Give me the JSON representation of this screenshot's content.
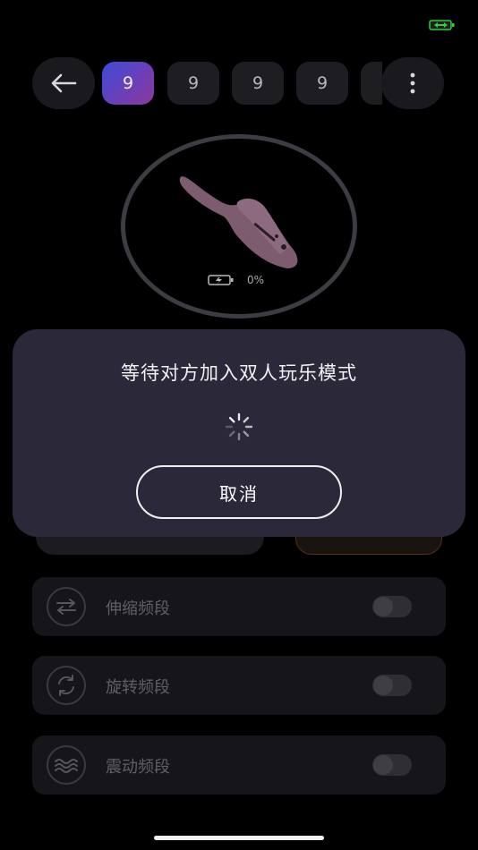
{
  "status": {
    "battery_icon": "battery-charging-icon",
    "battery_color": "#2ecc40"
  },
  "topbar": {
    "back_icon": "arrow-left-icon",
    "chips": [
      {
        "label": "9",
        "active": true
      },
      {
        "label": "9",
        "active": false
      },
      {
        "label": "9",
        "active": false
      },
      {
        "label": "9",
        "active": false
      }
    ],
    "more_icon": "more-vertical-icon"
  },
  "device": {
    "image": "toy-device-image",
    "battery_label": "0%"
  },
  "bands": [
    {
      "label": "伸缩频段",
      "icon": "swap-arrows-icon",
      "enabled": false
    },
    {
      "label": "旋转频段",
      "icon": "rotate-icon",
      "enabled": false
    },
    {
      "label": "震动频段",
      "icon": "wave-icon",
      "enabled": false
    }
  ],
  "modal": {
    "title": "等待对方加入双人玩乐模式",
    "spinner_icon": "loading-spinner-icon",
    "cancel_label": "取消"
  },
  "colors": {
    "modal_bg": "#2b2839",
    "chip_active_gradient_start": "#3c4bd8",
    "chip_active_gradient_end": "#8a3a9a"
  }
}
